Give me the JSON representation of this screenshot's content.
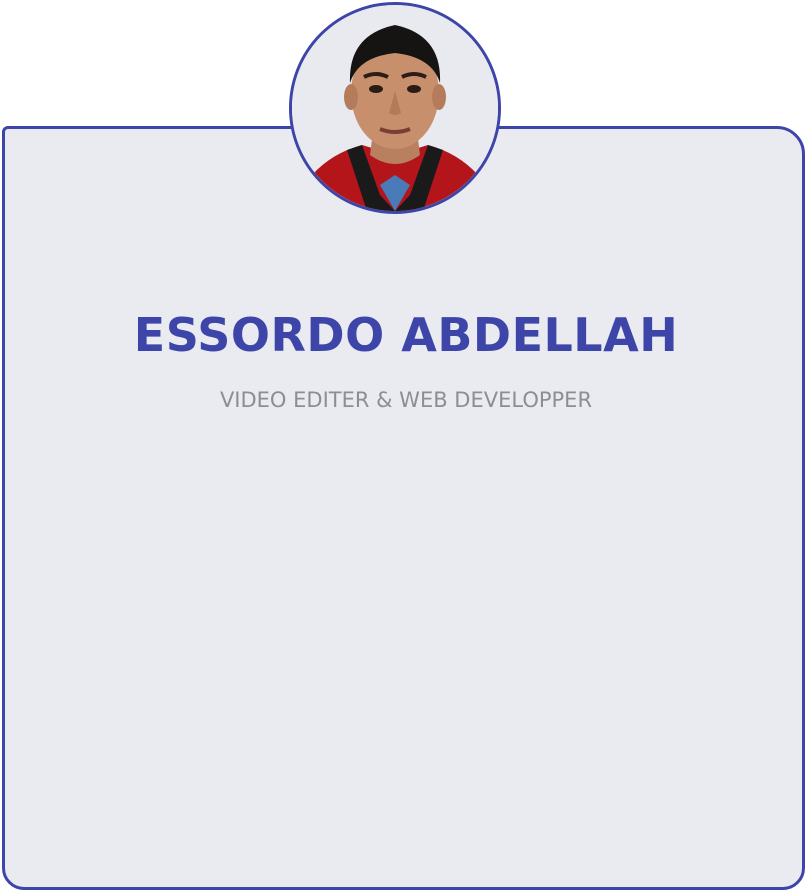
{
  "profile": {
    "name": "ESSORDO ABDELLAH",
    "role": "VIDEO EDITER & WEB DEVELOPPER",
    "avatar_icon": "profile-photo",
    "accent_color": "#3d45a8",
    "subtitle_color": "#8d8e92",
    "card_background": "#e9ebf1"
  }
}
